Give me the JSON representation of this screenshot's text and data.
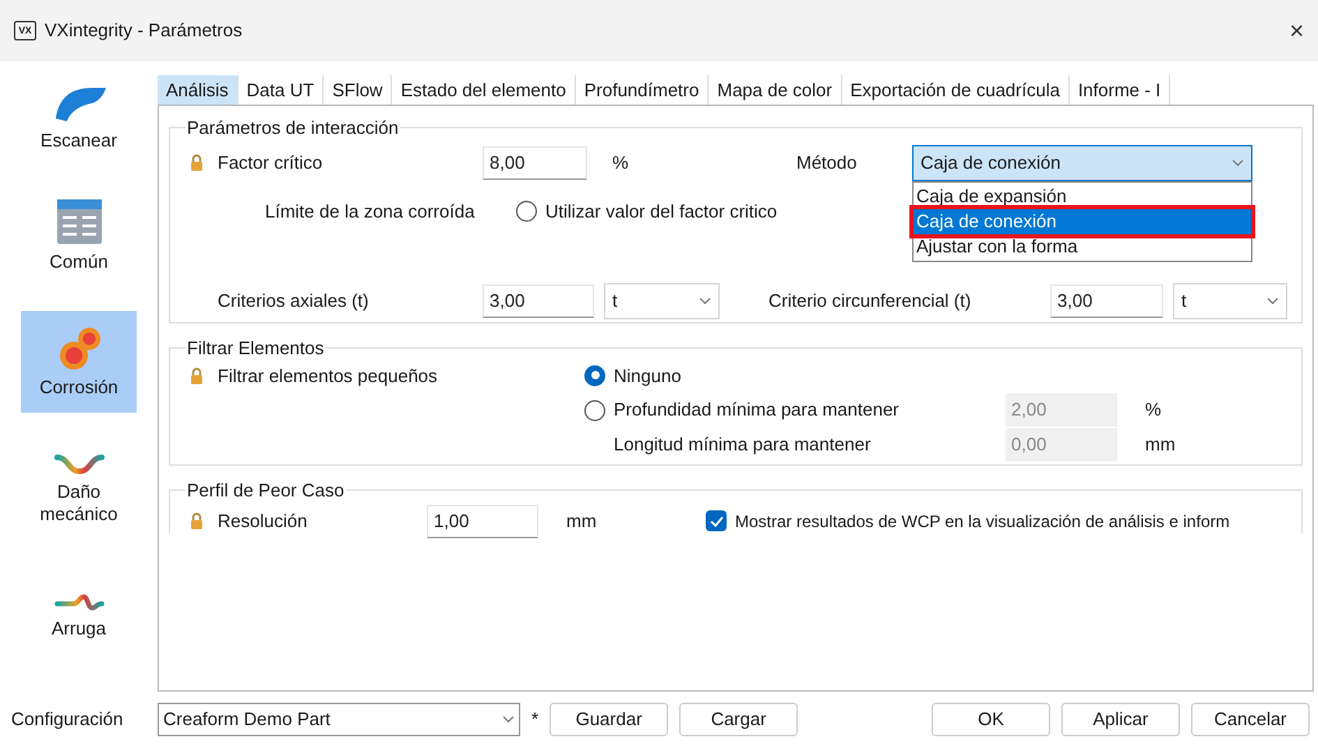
{
  "window": {
    "app_icon_text": "VX",
    "title": "VXintegrity - Parámetros",
    "close": "×"
  },
  "sidebar": {
    "items": [
      {
        "label": "Escanear",
        "selected": false
      },
      {
        "label": "Común",
        "selected": false
      },
      {
        "label": "Corrosión",
        "selected": true
      },
      {
        "label": "Daño mecánico",
        "selected": false
      },
      {
        "label": "Arruga",
        "selected": false
      }
    ]
  },
  "tabs": [
    {
      "label": "Análisis",
      "selected": true
    },
    {
      "label": "Data UT",
      "selected": false
    },
    {
      "label": "SFlow",
      "selected": false
    },
    {
      "label": "Estado del elemento",
      "selected": false
    },
    {
      "label": "Profundímetro",
      "selected": false
    },
    {
      "label": "Mapa de color",
      "selected": false
    },
    {
      "label": "Exportación de cuadrícula",
      "selected": false
    },
    {
      "label": "Informe - I",
      "selected": false
    }
  ],
  "interaction": {
    "title": "Parámetros de interacción",
    "critical_factor": {
      "label": "Factor crítico",
      "locked": true,
      "value": "8,00",
      "unit": "%"
    },
    "method": {
      "label": "Método",
      "value": "Caja de conexión",
      "expanded": true,
      "options": [
        {
          "label": "Caja de expansión",
          "selected": false
        },
        {
          "label": "Caja de conexión",
          "selected": true
        },
        {
          "label": "Ajustar con la forma",
          "selected": false
        }
      ]
    },
    "corroded_limit": {
      "label": "Límite de la zona corroída",
      "option": {
        "label": "Utilizar valor del factor critico",
        "selected": false
      }
    },
    "axial": {
      "label": "Criterios axiales (t)",
      "value": "3,00",
      "unit": "t"
    },
    "circumferential": {
      "label": "Criterio circunferencial (t)",
      "value": "3,00",
      "unit": "t"
    }
  },
  "filter": {
    "title": "Filtrar Elementos",
    "label": "Filtrar elementos pequeños",
    "locked": true,
    "options": [
      {
        "label": "Ninguno",
        "selected": true
      },
      {
        "label": "Profundidad mínima para mantener",
        "selected": false,
        "value": "2,00",
        "unit": "%",
        "disabled": true
      }
    ],
    "length": {
      "label": "Longitud mínima para mantener",
      "value": "0,00",
      "unit": "mm",
      "disabled": true
    }
  },
  "wcp": {
    "title": "Perfil de Peor Caso",
    "label": "Resolución",
    "locked": true,
    "value": "1,00",
    "unit": "mm",
    "show_wcp": {
      "label": "Mostrar resultados de WCP en la visualización de análisis e inform",
      "checked": true
    }
  },
  "footer": {
    "config_label": "Configuración",
    "config_value": "Creaform Demo Part",
    "modified_mark": "*",
    "buttons": [
      "Guardar",
      "Cargar"
    ],
    "dialog_buttons": [
      "OK",
      "Aplicar",
      "Cancelar"
    ]
  }
}
